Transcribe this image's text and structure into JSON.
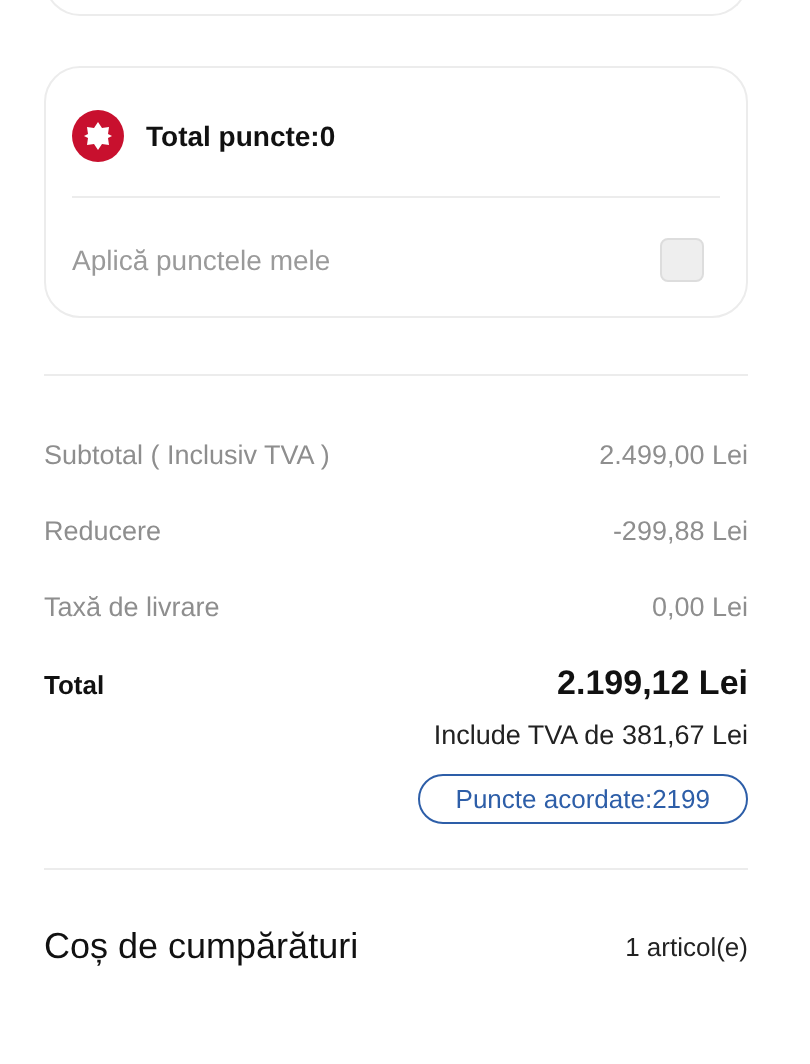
{
  "points": {
    "title": "Total puncte:0",
    "apply_label": "Aplică punctele mele",
    "apply_checked": false
  },
  "summary": [
    {
      "label": "Subtotal ( Inclusiv TVA )",
      "value": "2.499,00 Lei"
    },
    {
      "label": "Reducere",
      "value": "-299,88 Lei"
    },
    {
      "label": "Taxă de livrare",
      "value": "0,00 Lei"
    }
  ],
  "total": {
    "label": "Total",
    "value": "2.199,12 Lei",
    "vat_note": "Include TVA de 381,67 Lei",
    "points_badge": "Puncte acordate:2199"
  },
  "cart": {
    "title": "Coș de cumpărături",
    "count": "1 articol(e)"
  }
}
